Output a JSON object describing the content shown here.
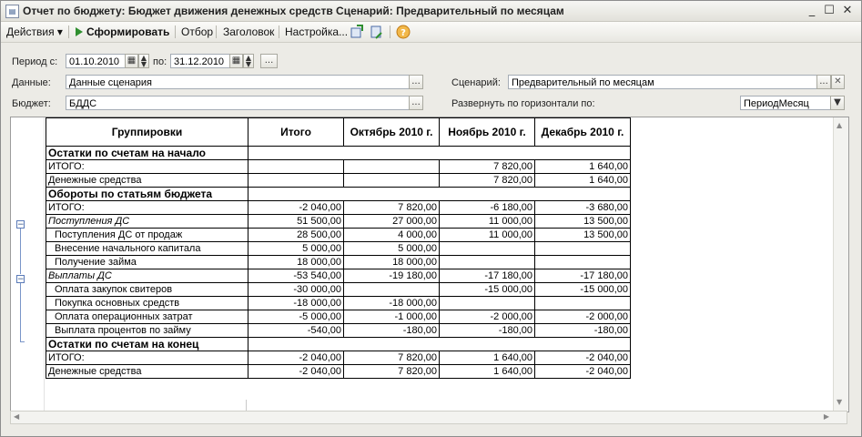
{
  "window": {
    "title": "Отчет по бюджету: Бюджет движения денежных средств Сценарий: Предварительный по месяцам",
    "minimize": "_",
    "maximize": "☐",
    "close": "✕"
  },
  "toolbar": {
    "actions_label": "Действия ▾",
    "generate_label": "Сформировать",
    "filter_label": "Отбор",
    "header_label": "Заголовок",
    "settings_label": "Настройка..."
  },
  "form": {
    "period_from_label": "Период с:",
    "period_from_value": "01.10.2010",
    "period_to_label": "по:",
    "period_to_value": "31.12.2010",
    "data_label": "Данные:",
    "data_value": "Данные сценария",
    "scenario_label": "Сценарий:",
    "scenario_value": "Предварительный по месяцам",
    "budget_label": "Бюджет:",
    "budget_value": "БДДС",
    "expand_label": "Развернуть по горизонтали по:",
    "expand_value": "ПериодМесяц",
    "ellipsis": "...",
    "clear_icon": "✕"
  },
  "report": {
    "headers": [
      "Группировки",
      "Итого",
      "Октябрь 2010 г.",
      "Ноябрь 2010 г.",
      "Декабрь 2010 г."
    ],
    "rows": [
      {
        "kind": "section",
        "cells": [
          "Остатки по счетам на начало",
          "",
          "",
          "",
          ""
        ]
      },
      {
        "kind": "plain",
        "cells": [
          "ИТОГО:",
          "",
          "",
          "7 820,00",
          "1 640,00"
        ]
      },
      {
        "kind": "plain",
        "cells": [
          "Денежные средства",
          "",
          "",
          "7 820,00",
          "1 640,00"
        ]
      },
      {
        "kind": "section",
        "cells": [
          "Обороты по статьям бюджета",
          "",
          "",
          "",
          ""
        ]
      },
      {
        "kind": "plain",
        "cells": [
          "ИТОГО:",
          "-2 040,00",
          "7 820,00",
          "-6 180,00",
          "-3 680,00"
        ]
      },
      {
        "kind": "italic",
        "cells": [
          "Поступления ДС",
          "51 500,00",
          "27 000,00",
          "11 000,00",
          "13 500,00"
        ]
      },
      {
        "kind": "indent",
        "cells": [
          "Поступления ДС от продаж",
          "28 500,00",
          "4 000,00",
          "11 000,00",
          "13 500,00"
        ]
      },
      {
        "kind": "indent",
        "cells": [
          "Внесение начального капитала",
          "5 000,00",
          "5 000,00",
          "",
          ""
        ]
      },
      {
        "kind": "indent",
        "cells": [
          "Получение займа",
          "18 000,00",
          "18 000,00",
          "",
          ""
        ]
      },
      {
        "kind": "italic",
        "cells": [
          "Выплаты ДС",
          "-53 540,00",
          "-19 180,00",
          "-17 180,00",
          "-17 180,00"
        ]
      },
      {
        "kind": "indent",
        "cells": [
          "Оплата закупок свитеров",
          "-30 000,00",
          "",
          "-15 000,00",
          "-15 000,00"
        ]
      },
      {
        "kind": "indent",
        "cells": [
          "Покупка основных средств",
          "-18 000,00",
          "-18 000,00",
          "",
          ""
        ]
      },
      {
        "kind": "indent",
        "cells": [
          "Оплата операционных затрат",
          "-5 000,00",
          "-1 000,00",
          "-2 000,00",
          "-2 000,00"
        ]
      },
      {
        "kind": "indent",
        "cells": [
          "Выплата процентов по займу",
          "-540,00",
          "-180,00",
          "-180,00",
          "-180,00"
        ]
      },
      {
        "kind": "section",
        "cells": [
          "Остатки по счетам на конец",
          "",
          "",
          "",
          ""
        ]
      },
      {
        "kind": "plain",
        "cells": [
          "ИТОГО:",
          "-2 040,00",
          "7 820,00",
          "1 640,00",
          "-2 040,00"
        ]
      },
      {
        "kind": "plain",
        "cells": [
          "Денежные средства",
          "-2 040,00",
          "7 820,00",
          "1 640,00",
          "-2 040,00"
        ]
      }
    ]
  },
  "colors": {
    "window_bg": "#ecebe6",
    "report_bg": "#ffffff",
    "grid_line": "#000000",
    "generate_arrow": "#2f8f2f",
    "help_icon": "#e8a33a"
  },
  "icons": {
    "generate": "play-triangle-icon",
    "calendar": "calendar-icon",
    "spinner": "up-down-spinner-icon",
    "help": "question-circle-icon",
    "save": "save-report-icon",
    "restore": "restore-report-icon",
    "collapse": "collapse-minus-icon"
  }
}
